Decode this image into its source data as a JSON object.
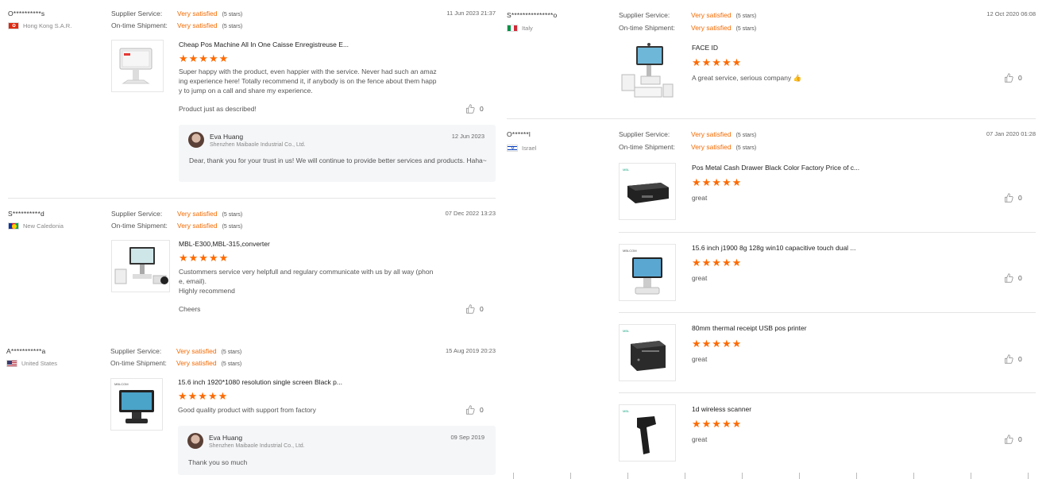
{
  "labels": {
    "supplier_service": "Supplier Service:",
    "ontime_shipment": "On-time Shipment:",
    "very_satisfied": "Very satisfied",
    "five_stars": "(5 stars)",
    "stars": "★★★★★"
  },
  "left_reviews": [
    {
      "user": "O**********s",
      "country": "Hong Kong S.A.R.",
      "date": "11 Jun 2023 21:37",
      "product_title": "Cheap Pos Machine All In One Caisse Enregistreuse E...",
      "text": "Super happy with the product, even happier with the service. Never had such an amazing experience here! Totally recommend it, if anybody is on the fence about them happy to jump on a call and share my experience.",
      "extra": "Product just as described!",
      "likes": "0",
      "reply": {
        "name": "Eva Huang",
        "company": "Shenzhen Maibaole Industrial Co., Ltd.",
        "date": "12 Jun 2023",
        "text": "Dear, thank you for your trust in us! We will continue to provide better services and products. Haha~"
      }
    },
    {
      "user": "S**********d",
      "country": "New Caledonia",
      "date": "07 Dec 2022 13:23",
      "product_title": "MBL-E300,MBL-315,converter",
      "text": "Custommers service very helpfull and regulary communicate with us by all way (phone, email).",
      "text2": "Highly recommend",
      "extra": "Cheers",
      "likes": "0"
    },
    {
      "user": "A***********a",
      "country": "United States",
      "date": "15 Aug 2019 20:23",
      "product_title": "15.6 inch 1920*1080 resolution single screen Black p...",
      "text": "Good quality product with support from factory",
      "likes": "0",
      "reply": {
        "name": "Eva Huang",
        "company": "Shenzhen Maibaole Industrial Co., Ltd.",
        "date": "09 Sep 2019",
        "text": "Thank you so much"
      }
    }
  ],
  "right_reviews": [
    {
      "user": "S***************o",
      "country": "Italy",
      "date": "12 Oct 2020 06:08",
      "items": [
        {
          "title": "FACE ID",
          "text": "A great service, serious company 👍",
          "likes": "0"
        }
      ]
    },
    {
      "user": "O******l",
      "country": "Israel",
      "date": "07 Jan 2020 01:28",
      "items": [
        {
          "title": "Pos Metal Cash Drawer Black Color Factory Price of c...",
          "text": "great",
          "likes": "0"
        },
        {
          "title": "15.6 inch j1900 8g 128g win10 capacitive touch dual ...",
          "text": "great",
          "likes": "0"
        },
        {
          "title": "80mm thermal receipt USB pos printer",
          "text": "great",
          "likes": "0"
        },
        {
          "title": "1d wireless scanner",
          "text": "great",
          "likes": "0"
        }
      ]
    }
  ],
  "colors": {
    "accent": "#f56a00",
    "star": "#ff6a00",
    "reply_bg": "#f5f6f8"
  }
}
